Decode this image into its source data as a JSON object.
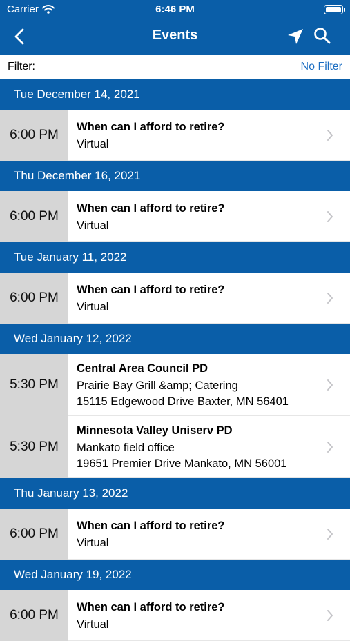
{
  "status": {
    "carrier": "Carrier",
    "time": "6:46 PM"
  },
  "nav": {
    "title": "Events"
  },
  "filter": {
    "label": "Filter:",
    "value": "No Filter"
  },
  "days": [
    {
      "date": "Tue December 14, 2021",
      "events": [
        {
          "time": "6:00 PM",
          "title": "When can I afford to retire?",
          "lines": [
            "Virtual"
          ]
        }
      ]
    },
    {
      "date": "Thu December 16, 2021",
      "events": [
        {
          "time": "6:00 PM",
          "title": "When can I afford to retire?",
          "lines": [
            "Virtual"
          ]
        }
      ]
    },
    {
      "date": "Tue January 11, 2022",
      "events": [
        {
          "time": "6:00 PM",
          "title": "When can I afford to retire?",
          "lines": [
            "Virtual"
          ]
        }
      ]
    },
    {
      "date": "Wed January 12, 2022",
      "events": [
        {
          "time": "5:30 PM",
          "title": "Central Area Council PD",
          "lines": [
            "Prairie Bay Grill &amp; Catering",
            "15115 Edgewood Drive Baxter, MN 56401"
          ]
        },
        {
          "time": "5:30 PM",
          "title": "Minnesota Valley Uniserv PD",
          "lines": [
            "Mankato field office",
            "19651 Premier Drive Mankato, MN 56001"
          ]
        }
      ]
    },
    {
      "date": "Thu January 13, 2022",
      "events": [
        {
          "time": "6:00 PM",
          "title": "When can I afford to retire?",
          "lines": [
            "Virtual"
          ]
        }
      ]
    },
    {
      "date": "Wed January 19, 2022",
      "events": [
        {
          "time": "6:00 PM",
          "title": "When can I afford to retire?",
          "lines": [
            "Virtual"
          ]
        }
      ]
    }
  ]
}
